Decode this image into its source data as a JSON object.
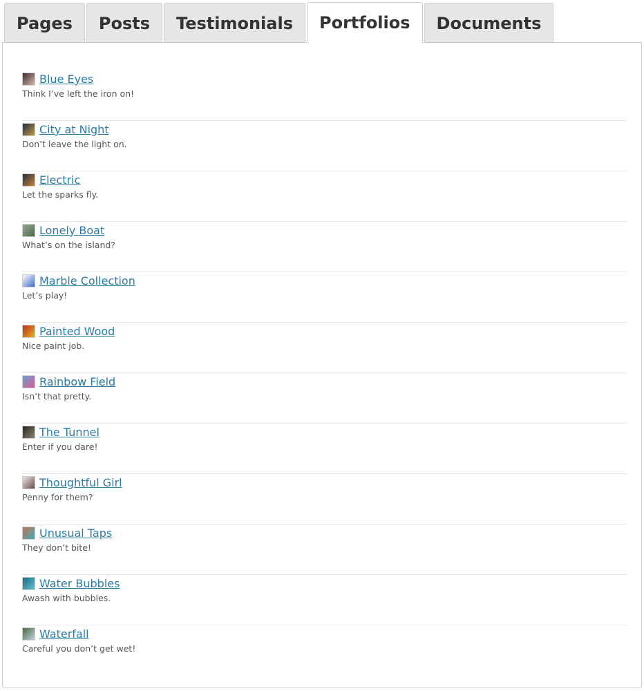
{
  "tabs": [
    {
      "label": "Pages",
      "active": false
    },
    {
      "label": "Posts",
      "active": false
    },
    {
      "label": "Testimonials",
      "active": false
    },
    {
      "label": "Portfolios",
      "active": true
    },
    {
      "label": "Documents",
      "active": false
    }
  ],
  "portfolios": [
    {
      "title": "Blue Eyes",
      "description": "Think I’ve left the iron on!",
      "thumbnail": "blue-eyes-thumbnail",
      "thumb_colors": [
        "#3a2a2a",
        "#d8b8b0"
      ]
    },
    {
      "title": "City at Night",
      "description": "Don’t leave the light on.",
      "thumbnail": "city-at-night-thumbnail",
      "thumb_colors": [
        "#1c2a4a",
        "#c89a40"
      ]
    },
    {
      "title": "Electric",
      "description": "Let the sparks fly.",
      "thumbnail": "electric-thumbnail",
      "thumb_colors": [
        "#20304a",
        "#d08030"
      ]
    },
    {
      "title": "Lonely Boat",
      "description": "What’s on the island?",
      "thumbnail": "lonely-boat-thumbnail",
      "thumb_colors": [
        "#9aa6a0",
        "#4a6a40"
      ]
    },
    {
      "title": "Marble Collection",
      "description": "Let’s play!",
      "thumbnail": "marble-collection-thumbnail",
      "thumb_colors": [
        "#ffffff",
        "#3a6ad0"
      ]
    },
    {
      "title": "Painted Wood",
      "description": "Nice paint job.",
      "thumbnail": "painted-wood-thumbnail",
      "thumb_colors": [
        "#c0301a",
        "#e0b020"
      ]
    },
    {
      "title": "Rainbow Field",
      "description": "Isn’t that pretty.",
      "thumbnail": "rainbow-field-thumbnail",
      "thumb_colors": [
        "#6aa0d8",
        "#e05a90"
      ]
    },
    {
      "title": "The Tunnel",
      "description": "Enter if you dare!",
      "thumbnail": "the-tunnel-thumbnail",
      "thumb_colors": [
        "#2a2820",
        "#8a8070"
      ]
    },
    {
      "title": "Thoughtful Girl",
      "description": "Penny for them?",
      "thumbnail": "thoughtful-girl-thumbnail",
      "thumb_colors": [
        "#f0e8e8",
        "#6a4a4a"
      ]
    },
    {
      "title": "Unusual Taps",
      "description": "They don’t bite!",
      "thumbnail": "unusual-taps-thumbnail",
      "thumb_colors": [
        "#c07050",
        "#40b0c0"
      ]
    },
    {
      "title": "Water Bubbles",
      "description": "Awash with bubbles.",
      "thumbnail": "water-bubbles-thumbnail",
      "thumb_colors": [
        "#1a6a80",
        "#60c0d0"
      ]
    },
    {
      "title": "Waterfall",
      "description": "Careful you don’t get wet!",
      "thumbnail": "waterfall-thumbnail",
      "thumb_colors": [
        "#4a6a40",
        "#c0d0e0"
      ]
    }
  ]
}
